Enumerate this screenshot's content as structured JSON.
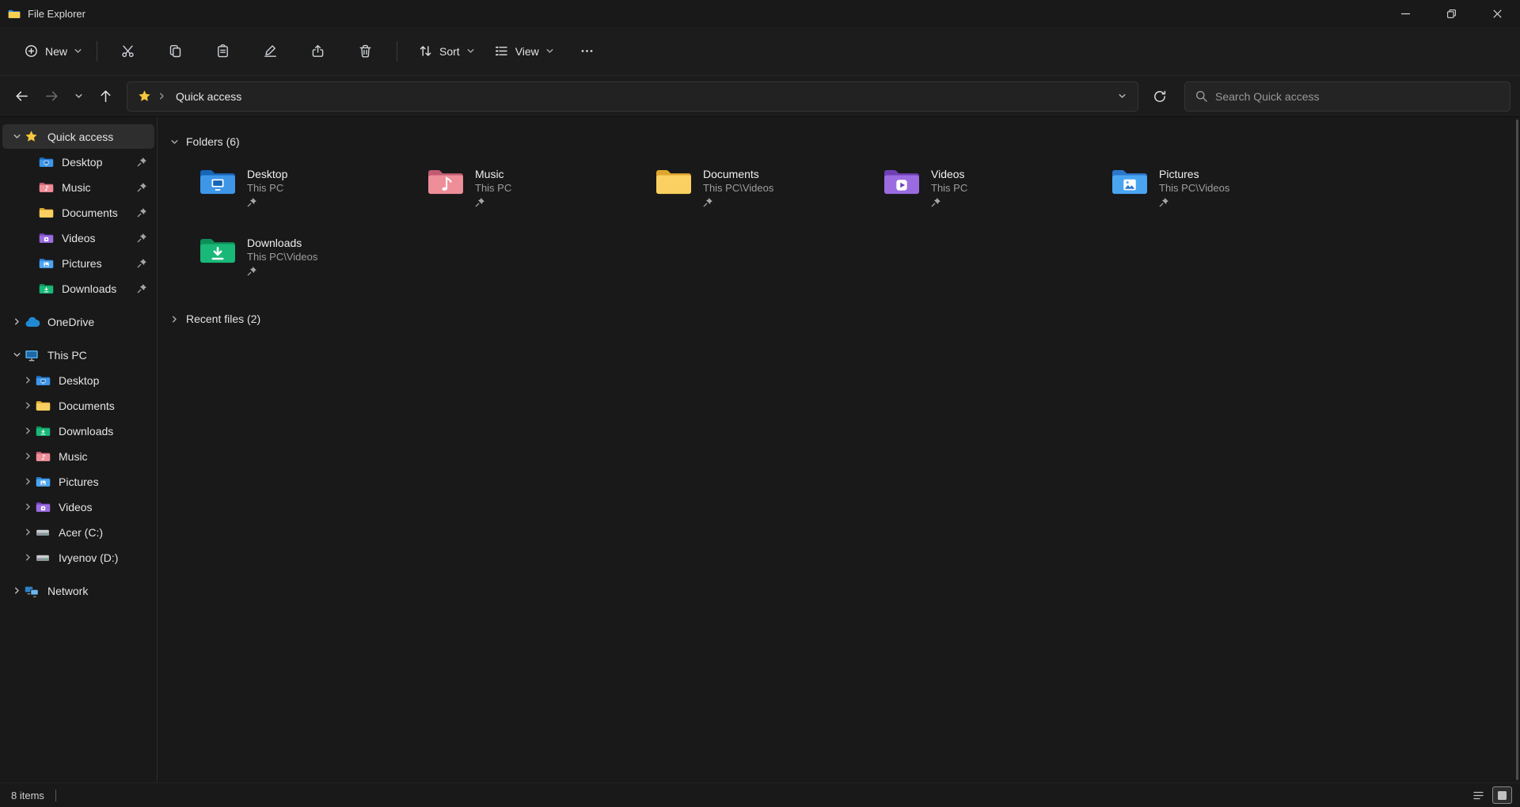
{
  "window": {
    "title": "File Explorer"
  },
  "toolbar": {
    "new": "New",
    "sort": "Sort",
    "view": "View"
  },
  "navbar": {
    "breadcrumb_root": "Quick access",
    "search_placeholder": "Search Quick access"
  },
  "sidebar": {
    "quick_access": {
      "label": "Quick access",
      "items": [
        {
          "label": "Desktop",
          "pinned": true
        },
        {
          "label": "Music",
          "pinned": true
        },
        {
          "label": "Documents",
          "pinned": true
        },
        {
          "label": "Videos",
          "pinned": true
        },
        {
          "label": "Pictures",
          "pinned": true
        },
        {
          "label": "Downloads",
          "pinned": true
        }
      ]
    },
    "onedrive": {
      "label": "OneDrive"
    },
    "this_pc": {
      "label": "This PC",
      "items": [
        {
          "label": "Desktop"
        },
        {
          "label": "Documents"
        },
        {
          "label": "Downloads"
        },
        {
          "label": "Music"
        },
        {
          "label": "Pictures"
        },
        {
          "label": "Videos"
        },
        {
          "label": "Acer (C:)"
        },
        {
          "label": "Ivyenov (D:)"
        }
      ]
    },
    "network": {
      "label": "Network"
    }
  },
  "main": {
    "folders_header": "Folders (6)",
    "folders": [
      {
        "name": "Desktop",
        "location": "This PC",
        "pinned": true
      },
      {
        "name": "Music",
        "location": "This PC",
        "pinned": true
      },
      {
        "name": "Documents",
        "location": "This PC\\Videos",
        "pinned": true
      },
      {
        "name": "Videos",
        "location": "This PC",
        "pinned": true
      },
      {
        "name": "Pictures",
        "location": "This PC\\Videos",
        "pinned": true
      },
      {
        "name": "Downloads",
        "location": "This PC\\Videos",
        "pinned": true
      }
    ],
    "recent_header": "Recent files (2)"
  },
  "statusbar": {
    "items_count": "8 items"
  },
  "icons": {
    "accent_star": "#f5c73d",
    "folder_colors": {
      "explorer": {
        "back": "#3f94e4",
        "front": "#f8cf4f"
      },
      "desktop": {
        "back": "#1565b8",
        "front": "#3e96e8"
      },
      "music": {
        "back": "#c05a72",
        "front": "#ee8e98"
      },
      "documents": {
        "back": "#dfa62e",
        "front": "#f9d061"
      },
      "videos": {
        "back": "#6f3fb4",
        "front": "#9a6ce0"
      },
      "pictures": {
        "back": "#2a76cc",
        "front": "#4aa5f1"
      },
      "downloads": {
        "back": "#0d8f58",
        "front": "#19b878"
      }
    }
  }
}
